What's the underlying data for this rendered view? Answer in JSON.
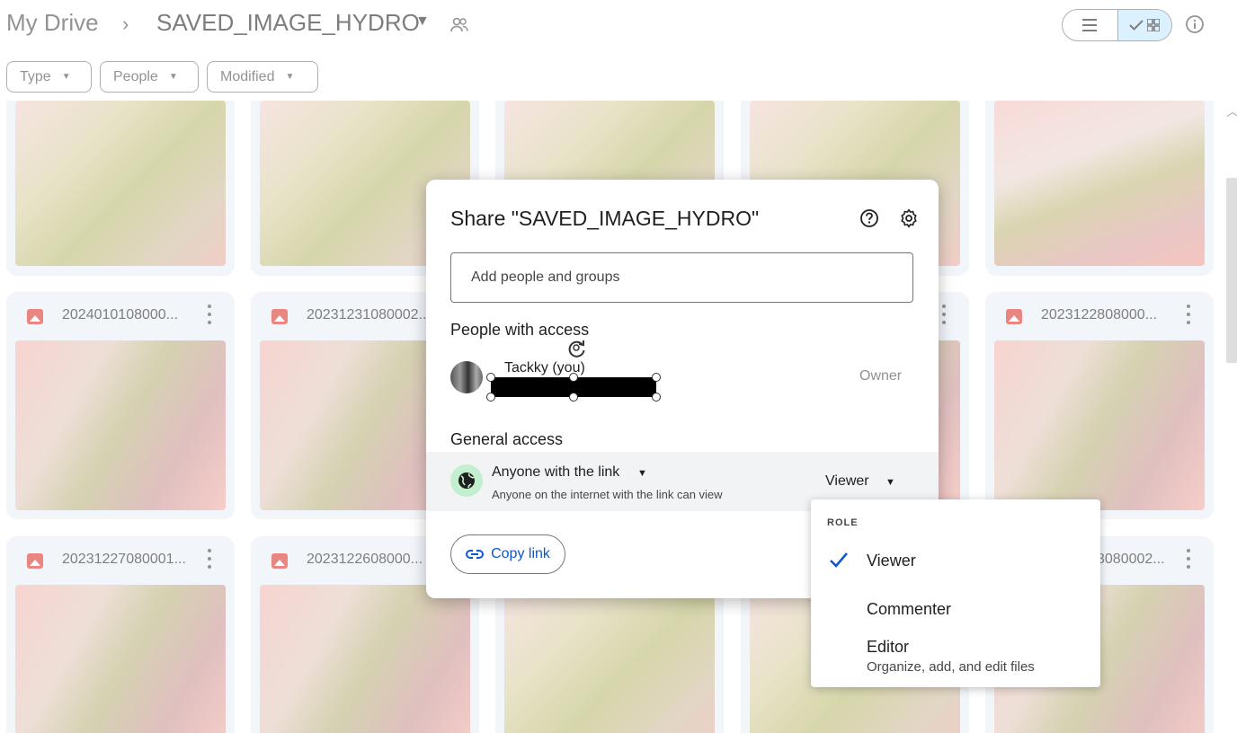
{
  "header": {
    "root": "My Drive",
    "separator": "›",
    "current_folder": "SAVED_IMAGE_HYDRO"
  },
  "filters": [
    "Type",
    "People",
    "Modified"
  ],
  "files": [
    "2024010108000...",
    "20231231080002...",
    "",
    "",
    "2023122808000...",
    "20231227080001...",
    "2023122608000...",
    "",
    "",
    "3080002..."
  ],
  "share_dialog": {
    "title": "Share \"SAVED_IMAGE_HYDRO\"",
    "add_placeholder": "Add people and groups",
    "people_heading": "People with access",
    "person_name": "Tackky (you)",
    "person_role": "Owner",
    "general_heading": "General access",
    "access_level": "Anyone with the link",
    "access_desc": "Anyone on the internet with the link can view",
    "current_role": "Viewer",
    "copy_link": "Copy link"
  },
  "role_menu": {
    "header": "ROLE",
    "items": [
      {
        "label": "Viewer",
        "desc": "",
        "selected": true
      },
      {
        "label": "Commenter",
        "desc": "",
        "selected": false
      },
      {
        "label": "Editor",
        "desc": "Organize, add, and edit files",
        "selected": false
      }
    ]
  },
  "colors": {
    "accent": "#0b57d0",
    "selected_view": "#c2e7ff",
    "image_icon": "#d93025",
    "globe_bg": "#c4eed0"
  }
}
